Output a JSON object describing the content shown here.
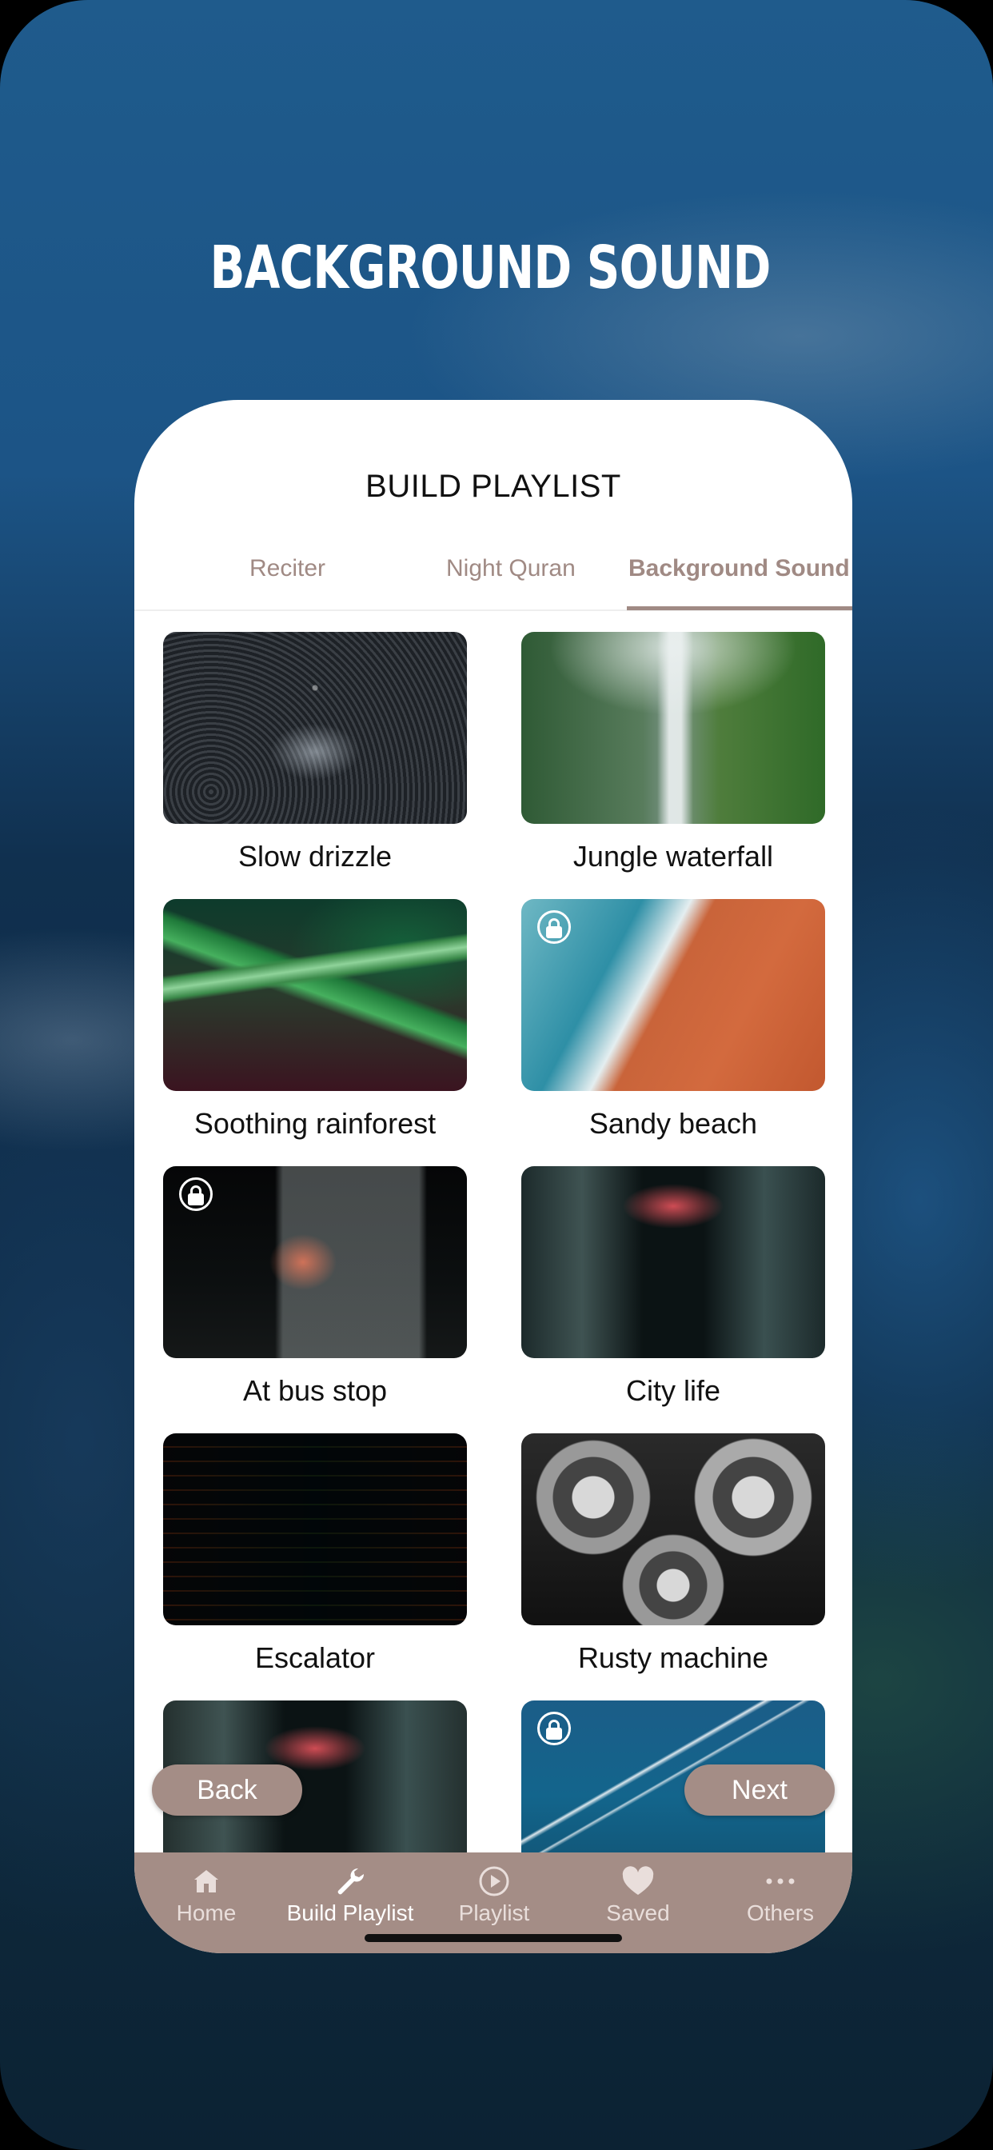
{
  "headline": "BACKGROUND SOUND",
  "screen": {
    "title": "BUILD PLAYLIST",
    "tabs": [
      {
        "label": "Reciter",
        "active": false
      },
      {
        "label": "Night Quran",
        "active": false
      },
      {
        "label": "Background Sound",
        "active": true
      }
    ],
    "sounds": [
      {
        "label": "Slow drizzle",
        "locked": false,
        "image": "rain-drops-splash"
      },
      {
        "label": "Jungle waterfall",
        "locked": false,
        "image": "jungle-waterfall"
      },
      {
        "label": "Soothing rainforest",
        "locked": false,
        "image": "rainforest-leaves"
      },
      {
        "label": "Sandy beach",
        "locked": true,
        "image": "aerial-beach"
      },
      {
        "label": "At bus stop",
        "locked": true,
        "image": "night-bus-stop"
      },
      {
        "label": "City life",
        "locked": false,
        "image": "city-alley-night"
      },
      {
        "label": "Escalator",
        "locked": false,
        "image": "escalator-steps"
      },
      {
        "label": "Rusty machine",
        "locked": false,
        "image": "metal-gears"
      },
      {
        "label": "",
        "locked": false,
        "image": "city-alley-night"
      },
      {
        "label": "",
        "locked": true,
        "image": "airplane-contrails-sky"
      }
    ],
    "buttons": {
      "back": "Back",
      "next": "Next"
    },
    "nav": [
      {
        "label": "Home",
        "icon": "home-icon",
        "active": false
      },
      {
        "label": "Build Playlist",
        "icon": "wrench-icon",
        "active": true
      },
      {
        "label": "Playlist",
        "icon": "play-circle-icon",
        "active": false
      },
      {
        "label": "Saved",
        "icon": "heart-icon",
        "active": false
      },
      {
        "label": "Others",
        "icon": "more-dots-icon",
        "active": false
      }
    ]
  },
  "colors": {
    "accent": "#a48d86",
    "tab_text": "#a08a84",
    "background_blue": "#1f5b8c"
  }
}
